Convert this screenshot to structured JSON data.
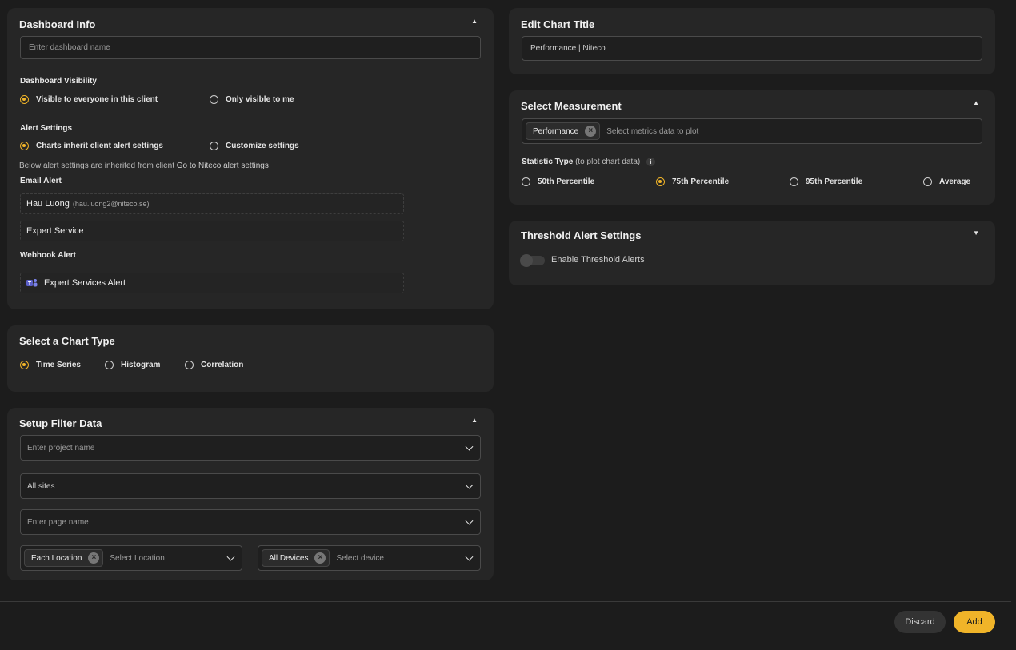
{
  "dashboard_info": {
    "title": "Dashboard Info",
    "name_placeholder": "Enter dashboard name",
    "visibility_label": "Dashboard Visibility",
    "visibility_options": [
      "Visible to everyone in this client",
      "Only visible to me"
    ],
    "visibility_selected": 0,
    "alert_label": "Alert Settings",
    "alert_options": [
      "Charts inherit client alert settings",
      "Customize settings"
    ],
    "alert_selected": 0,
    "inherit_note": "Below alert settings are inherited from client",
    "inherit_link": "Go to Niteco alert settings",
    "email_alert_label": "Email Alert",
    "email_recipients": [
      {
        "name": "Hau Luong",
        "email": "(hau.luong2@niteco.se)"
      },
      {
        "name": "Expert Service",
        "email": ""
      }
    ],
    "webhook_label": "Webhook Alert",
    "webhooks": [
      {
        "name": "Expert Services Alert",
        "icon": "teams-icon"
      }
    ]
  },
  "chart_type": {
    "title": "Select a Chart Type",
    "options": [
      "Time Series",
      "Histogram",
      "Correlation"
    ],
    "selected": 0
  },
  "filter": {
    "title": "Setup Filter Data",
    "project_placeholder": "Enter project name",
    "sites_value": "All sites",
    "page_placeholder": "Enter page name",
    "location_chip": "Each Location",
    "location_placeholder": "Select Location",
    "device_chip": "All Devices",
    "device_placeholder": "Select device"
  },
  "chart_title": {
    "title": "Edit Chart Title",
    "value": "Performance | Niteco"
  },
  "measurement": {
    "title": "Select Measurement",
    "chip": "Performance",
    "placeholder": "Select metrics data to plot",
    "stat_label": "Statistic Type",
    "stat_hint": "(to plot chart data)",
    "stat_options": [
      "50th Percentile",
      "75th Percentile",
      "95th Percentile",
      "Average"
    ],
    "stat_selected": 1
  },
  "threshold": {
    "title": "Threshold Alert Settings",
    "toggle_label": "Enable Threshold Alerts",
    "enabled": false
  },
  "footer": {
    "discard_label": "Discard",
    "add_label": "Add"
  },
  "colors": {
    "accent": "#f0b429",
    "panel": "#262626",
    "background": "#1c1c1c"
  }
}
